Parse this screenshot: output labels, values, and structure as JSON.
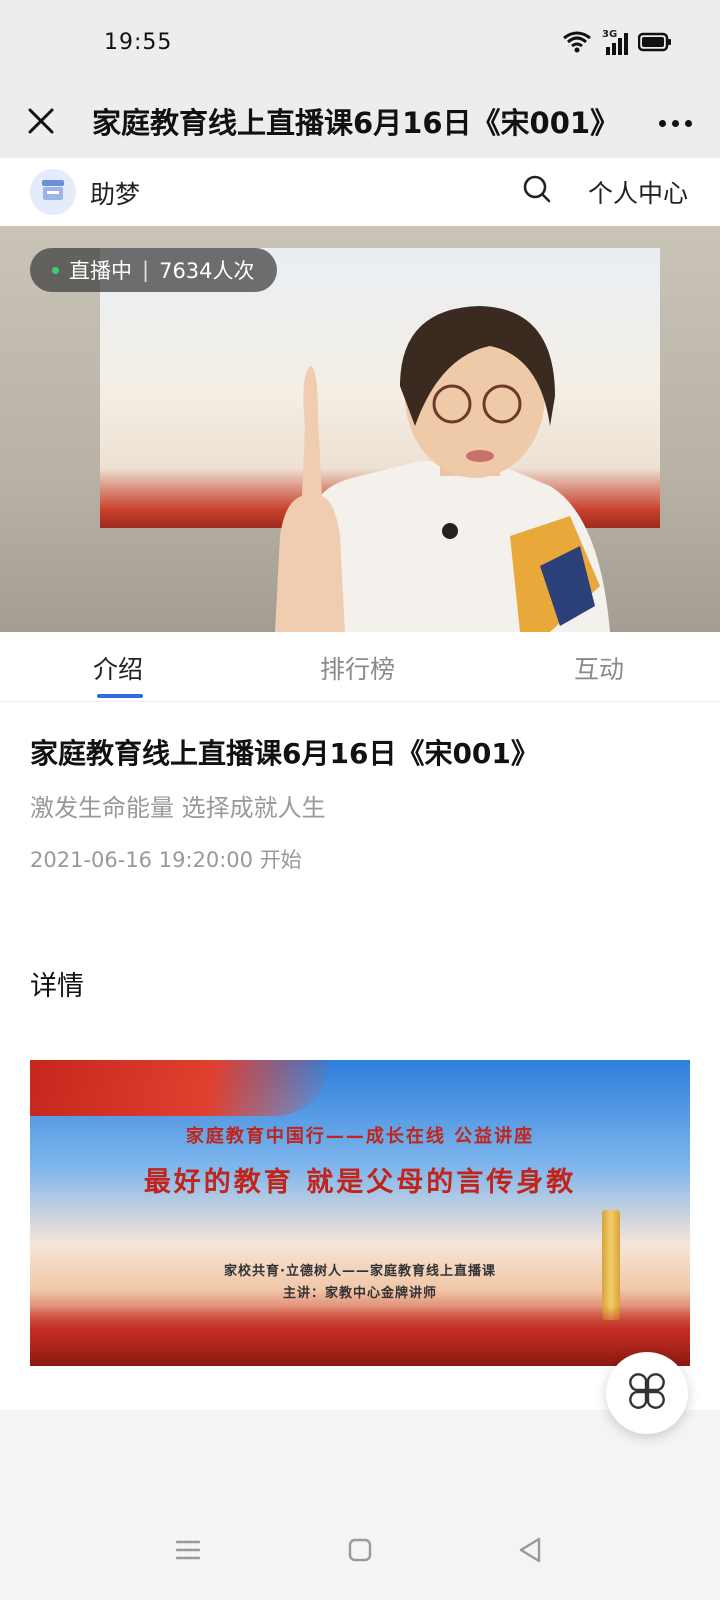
{
  "status_bar": {
    "time": "19:55",
    "network": "3G"
  },
  "title_bar": {
    "title": "家庭教育线上直播课6月16日《宋001》",
    "close_icon": "close-icon",
    "more_icon": "more-dots-icon"
  },
  "shop": {
    "name": "助梦",
    "profile_label": "个人中心"
  },
  "video": {
    "status": "直播中",
    "viewers": "7634人次"
  },
  "tabs": [
    {
      "label": "介绍",
      "active": true
    },
    {
      "label": "排行榜",
      "active": false
    },
    {
      "label": "互动",
      "active": false
    }
  ],
  "intro": {
    "title": "家庭教育线上直播课6月16日《宋001》",
    "subtitle": "激发生命能量 选择成就人生",
    "start": "2021-06-16 19:20:00 开始",
    "details_heading": "详情"
  },
  "banner": {
    "line1": "家庭教育中国行——成长在线 公益讲座",
    "line2": "最好的教育 就是父母的言传身教",
    "line3": "家校共育·立德树人——家庭教育线上直播课",
    "line4": "主讲：家教中心金牌讲师"
  },
  "colors": {
    "accent": "#2f6bde",
    "live_dot": "#38d26a",
    "banner_red": "#c0241a"
  }
}
